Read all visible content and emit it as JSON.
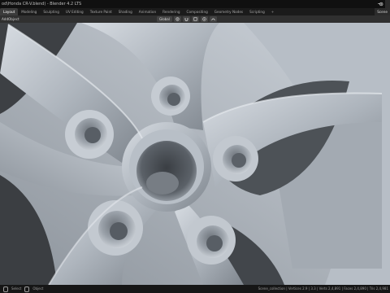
{
  "window": {
    "title": "od\\Honda CR-V.blend) - Blender 4.2 LTS",
    "logo_icon": "blender-logo-icon",
    "user_icon": "user-icon"
  },
  "workspace_tabs": [
    {
      "label": "Layout",
      "active": true
    },
    {
      "label": "Modeling",
      "active": false
    },
    {
      "label": "Sculpting",
      "active": false
    },
    {
      "label": "UV Editing",
      "active": false
    },
    {
      "label": "Texture Paint",
      "active": false
    },
    {
      "label": "Shading",
      "active": false
    },
    {
      "label": "Animation",
      "active": false
    },
    {
      "label": "Rendering",
      "active": false
    },
    {
      "label": "Compositing",
      "active": false
    },
    {
      "label": "Geometry Nodes",
      "active": false
    },
    {
      "label": "Scripting",
      "active": false
    },
    {
      "label": "+",
      "active": false
    }
  ],
  "scene_selector": {
    "label": "Scene"
  },
  "header": {
    "menu_add": "Add",
    "menu_object": "Object",
    "transform_orientation": "Global",
    "pivot_icon": "pivot-icon",
    "snap_icon": "snap-magnet-icon",
    "snap_target_icon": "snap-target-icon",
    "proportional_icon": "proportional-edit-icon",
    "falloff_icon": "falloff-curve-icon"
  },
  "statusbar": {
    "left_icon": "mouse-left-icon",
    "left_label": "Select",
    "mid_icon": "mouse-middle-icon",
    "mid_label": "Object",
    "stats": "Scene_collection | Vertices 2.9 | 3.3 | Verts 2,4,891 | Faces 2,4,890 | Tris 2,4,981"
  },
  "colors": {
    "viewport_bg": "#2b2b2b",
    "model_light": "#c9cfd6",
    "model_mid": "#9aa2ab",
    "model_dark": "#4b5158",
    "active_tab": "#3b3b3b"
  }
}
